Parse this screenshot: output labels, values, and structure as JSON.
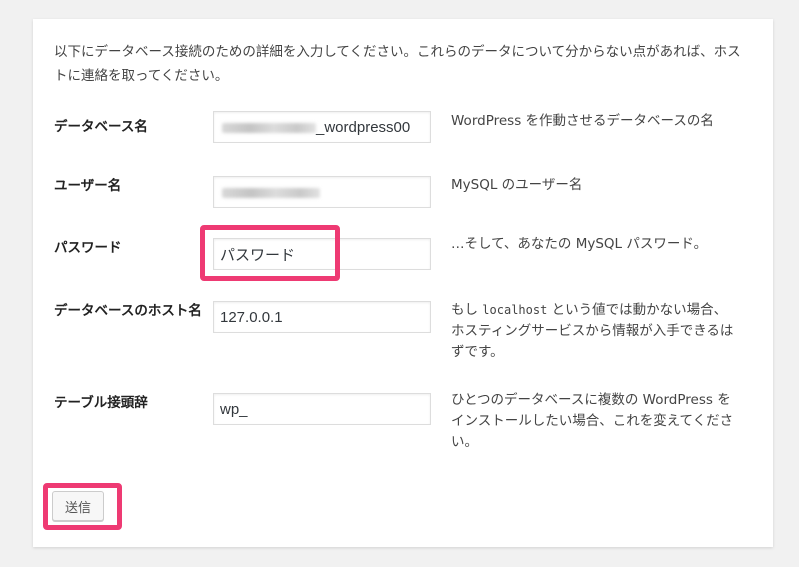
{
  "intro": "以下にデータベース接続のための詳細を入力してください。これらのデータについて分からない点があれば、ホストに連絡を取ってください。",
  "fields": {
    "dbname": {
      "label": "データベース名",
      "value_suffix": "_wordpress00",
      "help": "WordPress を作動させるデータベースの名"
    },
    "username": {
      "label": "ユーザー名",
      "help": "MySQL のユーザー名"
    },
    "password": {
      "label": "パスワード",
      "value": "パスワード",
      "help": "…そして、あなたの MySQL パスワード。"
    },
    "host": {
      "label": "データベースのホスト名",
      "value": "127.0.0.1",
      "help_before": "もし ",
      "help_code": "localhost",
      "help_after": " という値では動かない場合、ホスティングサービスから情報が入手できるはずです。"
    },
    "prefix": {
      "label": "テーブル接頭辞",
      "value": "wp_",
      "help": "ひとつのデータベースに複数の WordPress をインストールしたい場合、これを変えてください。"
    }
  },
  "submit_label": "送信",
  "colors": {
    "background": "#f1f1f1",
    "card": "#ffffff",
    "highlight": "#ee3a73",
    "text": "#444444"
  }
}
